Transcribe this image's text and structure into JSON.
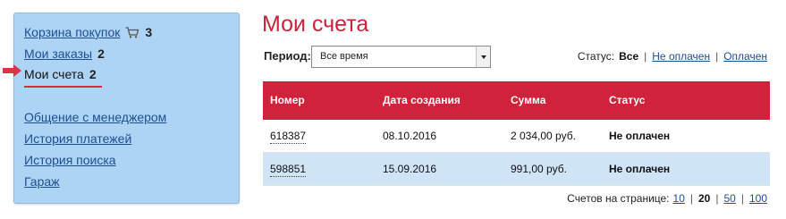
{
  "sidebar": {
    "items": [
      {
        "label": "Корзина покупок",
        "count": "3",
        "icon": "cart-icon"
      },
      {
        "label": "Мои заказы",
        "count": "2"
      },
      {
        "label": "Мои счета",
        "count": "2"
      },
      {
        "label": "Общение с менеджером"
      },
      {
        "label": "История платежей"
      },
      {
        "label": "История поиска"
      },
      {
        "label": "Гараж"
      }
    ],
    "marker_icon": "arrow-right-icon",
    "background": "#aed4f5"
  },
  "page": {
    "title": "Мои счета",
    "accent": "#c8243c"
  },
  "period": {
    "label": "Период:",
    "selected": "Все время"
  },
  "status_filter": {
    "label": "Статус:",
    "active": "Все",
    "options": [
      "Не оплачен",
      "Оплачен"
    ]
  },
  "table": {
    "header_color": "#d0223a",
    "columns": [
      "Номер",
      "Дата создания",
      "Сумма",
      "Статус"
    ],
    "rows": [
      {
        "number": "618387",
        "date": "08.10.2016",
        "sum": "2 034,00 руб.",
        "status": "Не оплачен"
      },
      {
        "number": "598851",
        "date": "15.09.2016",
        "sum": "991,00 руб.",
        "status": "Не оплачен"
      }
    ]
  },
  "pager": {
    "label": "Счетов на странице:",
    "options": [
      "10",
      "20",
      "50",
      "100"
    ],
    "active": "20"
  }
}
